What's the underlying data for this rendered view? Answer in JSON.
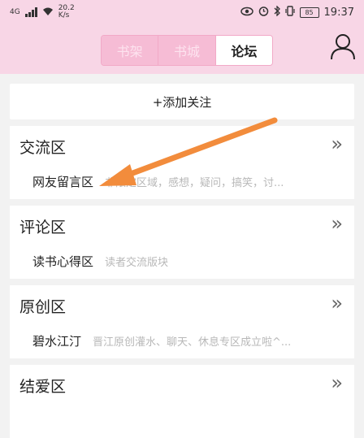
{
  "status_bar": {
    "network": "4G",
    "speed_value": "20.2",
    "speed_unit": "K/s",
    "battery": "85",
    "time": "19:37"
  },
  "tabs": [
    {
      "label": "书架",
      "active": false
    },
    {
      "label": "书城",
      "active": false
    },
    {
      "label": "论坛",
      "active": true
    }
  ],
  "add_follow_label": "+添加关注",
  "sections": [
    {
      "title": "交流区",
      "more": "»",
      "item_name": "网友留言区",
      "item_desc": "非限定区域，感想，疑问，搞笑，讨..."
    },
    {
      "title": "评论区",
      "more": "»",
      "item_name": "读书心得区",
      "item_desc": "读者交流版块"
    },
    {
      "title": "原创区",
      "more": "»",
      "item_name": "碧水江汀",
      "item_desc": "晋江原创灌水、聊天、休息专区成立啦^..."
    },
    {
      "title": "结爱区",
      "more": "»"
    }
  ],
  "colors": {
    "header_bg": "#f8d6e6",
    "tab_inactive_bg": "#f6bcd5",
    "arrow": "#f28c3c"
  }
}
